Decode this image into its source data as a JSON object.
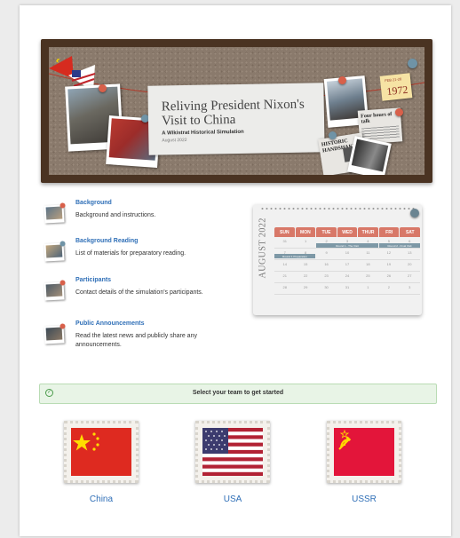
{
  "banner": {
    "title": "Reliving President Nixon's Visit to China",
    "subtitle": "A Wikistrat Historical Simulation",
    "date": "August 2022",
    "sticky_small": "FEB 21-28",
    "sticky_year": "1972",
    "newspaper_headlines": [
      "Four hours of talk",
      "HISTORIC HANDSHAKE"
    ]
  },
  "sections": [
    {
      "title": "Background",
      "description": "Background and instructions."
    },
    {
      "title": "Background Reading",
      "description": "List of materials for preparatory reading."
    },
    {
      "title": "Participants",
      "description": "Contact details of the simulation's participants."
    },
    {
      "title": "Public Announcements",
      "description": "Read the latest news and publicly share any announcements."
    }
  ],
  "calendar": {
    "month": "AUGUST 2022",
    "days": [
      "SUN",
      "MON",
      "TUE",
      "WED",
      "THUR",
      "FRI",
      "SAT"
    ],
    "weeks": [
      [
        "31",
        "1",
        "2",
        "3",
        "4",
        "5",
        "6"
      ],
      [
        "7",
        "8",
        "9",
        "10",
        "11",
        "12",
        "13"
      ],
      [
        "14",
        "15",
        "16",
        "17",
        "18",
        "19",
        "20"
      ],
      [
        "21",
        "22",
        "23",
        "24",
        "25",
        "26",
        "27"
      ],
      [
        "28",
        "29",
        "30",
        "31",
        "1",
        "2",
        "3"
      ]
    ],
    "events": [
      "Round 1 - The Visit",
      "Round 2 - Final Visit",
      "Round 1 Preparation"
    ]
  },
  "alert": {
    "message": "Select your team to get started"
  },
  "teams": [
    {
      "name": "China",
      "flag": "china"
    },
    {
      "name": "USA",
      "flag": "usa"
    },
    {
      "name": "USSR",
      "flag": "ussr"
    }
  ],
  "colors": {
    "link": "#2f6fb7",
    "alert_bg": "#e8f4e6",
    "calendar_header": "#d87868"
  }
}
